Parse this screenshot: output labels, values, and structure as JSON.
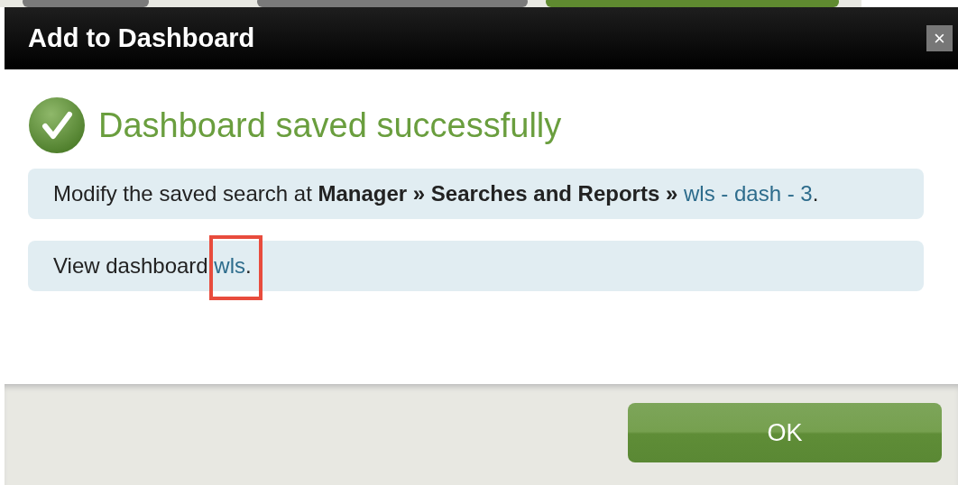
{
  "dialog": {
    "title": "Add to Dashboard",
    "close": "×"
  },
  "status": {
    "kind": "success",
    "heading": "Dashboard saved successfully"
  },
  "notices": [
    {
      "text": "Modify the saved search at **Manager » Searches and Reports »**",
      "link": "wls - dash - 3",
      "suffix": ".",
      "highlighted": false
    },
    {
      "text": "View dashboard",
      "link": "wls",
      "suffix": ".",
      "highlighted": true
    }
  ],
  "buttons": [
    {
      "label": "OK"
    }
  ]
}
